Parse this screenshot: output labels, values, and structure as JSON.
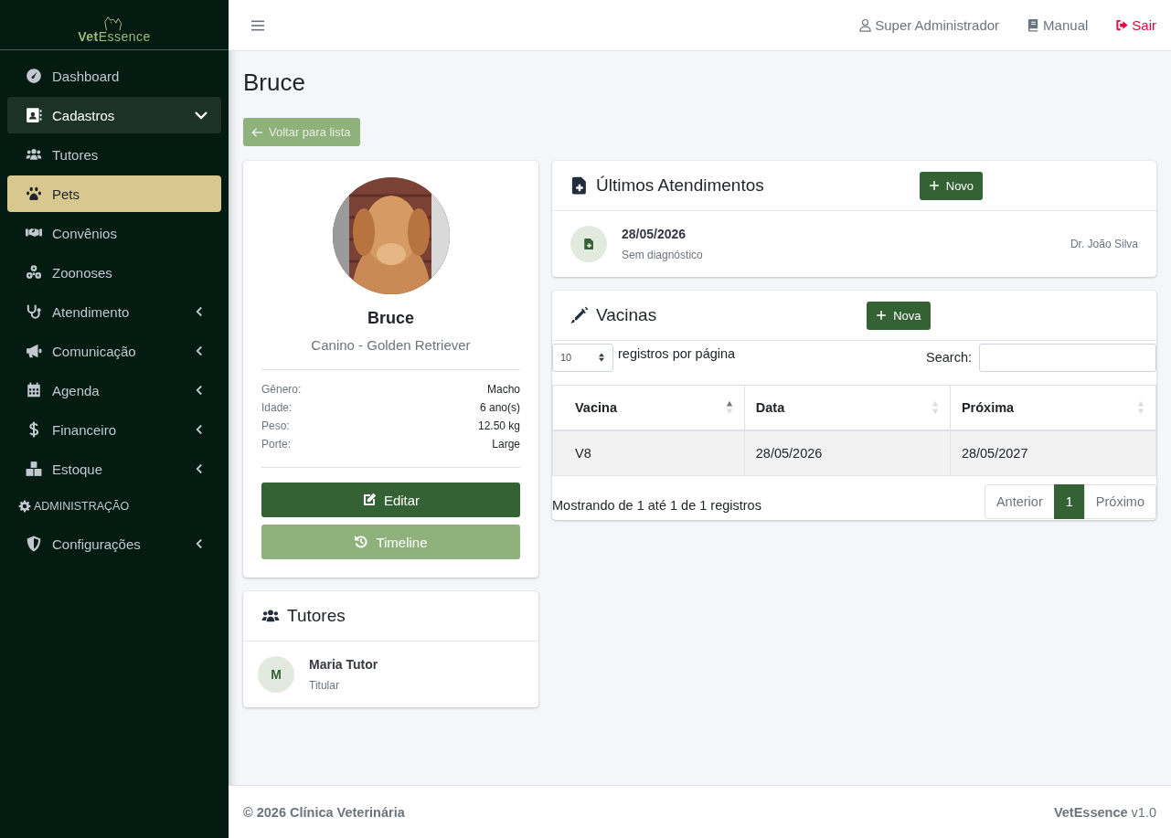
{
  "sidebar": {
    "logo": "**Vet**Essence",
    "items": [
      {
        "kind": "link",
        "label": "Dashboard",
        "selected": false
      },
      {
        "kind": "menu",
        "label": "Cadastros",
        "selected": false,
        "expanded": true,
        "children": [
          {
            "kind": "link",
            "label": "Tutores",
            "selected": false
          },
          {
            "kind": "link",
            "label": "Pets",
            "selected": true
          },
          {
            "kind": "link",
            "label": "Convênios",
            "selected": false
          },
          {
            "kind": "link",
            "label": "Zoonoses",
            "selected": false
          }
        ]
      },
      {
        "kind": "menu",
        "label": "Atendimento",
        "selected": false,
        "expanded": false
      },
      {
        "kind": "menu",
        "label": "Comunicação",
        "selected": false,
        "expanded": false
      },
      {
        "kind": "menu",
        "label": "Agenda",
        "selected": false,
        "expanded": false
      },
      {
        "kind": "menu",
        "label": "Financeiro",
        "selected": false,
        "expanded": false
      },
      {
        "kind": "menu",
        "label": "Estoque",
        "selected": false,
        "expanded": false
      },
      {
        "kind": "header",
        "label": "ADMINISTRAÇÃO"
      },
      {
        "kind": "menu",
        "label": "Configurações",
        "selected": false,
        "expanded": false
      }
    ]
  },
  "navbar": {
    "user": "Super Administrador",
    "manual": "Manual",
    "logout": "Sair"
  },
  "page_title": "Bruce",
  "back_button": "Voltar para lista",
  "pet_card": {
    "name": "Bruce",
    "breed": "Canino - Golden Retriever",
    "details": [
      {
        "label": "Gênero:",
        "value": "Macho"
      },
      {
        "label": "Idade:",
        "value": "6 ano(s)"
      },
      {
        "label": "Peso:",
        "value": "12.50 kg"
      },
      {
        "label": "Porte:",
        "value": "Large"
      }
    ],
    "buttons": [
      {
        "kind": "edit",
        "label": "Editar"
      },
      {
        "kind": "timeline",
        "label": "Timeline"
      }
    ]
  },
  "tutors_card": {
    "title": "Tutores",
    "tutors": [
      {
        "initial": "M",
        "name": "Maria Tutor",
        "role": "Titular"
      }
    ]
  },
  "appointments_card": {
    "title": "Últimos Atendimentos",
    "new_button": "Novo",
    "items": [
      {
        "date": "28/05/2026",
        "diagnosis": "Sem diagnóstico",
        "vet": "Dr. João Silva"
      }
    ]
  },
  "vaccines_card": {
    "title": "Vacinas",
    "new_button": "Nova",
    "page_length": "10",
    "length_label": "registros por página",
    "search_label": "Search:",
    "columns": [
      {
        "label": "Vacina",
        "sorted": true
      },
      {
        "label": "Data",
        "sorted": false
      },
      {
        "label": "Próxima",
        "sorted": false
      }
    ],
    "rows": [
      [
        "V8",
        "28/05/2026",
        "28/05/2027"
      ]
    ],
    "info": "Mostrando de 1 até 1 de 1 registros",
    "pagination": [
      {
        "label": "Anterior",
        "selected": false,
        "disabled": true
      },
      {
        "label": "1",
        "selected": true,
        "disabled": false
      },
      {
        "label": "Próximo",
        "selected": false,
        "disabled": true
      }
    ]
  },
  "footer": {
    "copyright": "© 2026 Clínica Veterinária",
    "version": "**VetEssence** v1.0"
  }
}
